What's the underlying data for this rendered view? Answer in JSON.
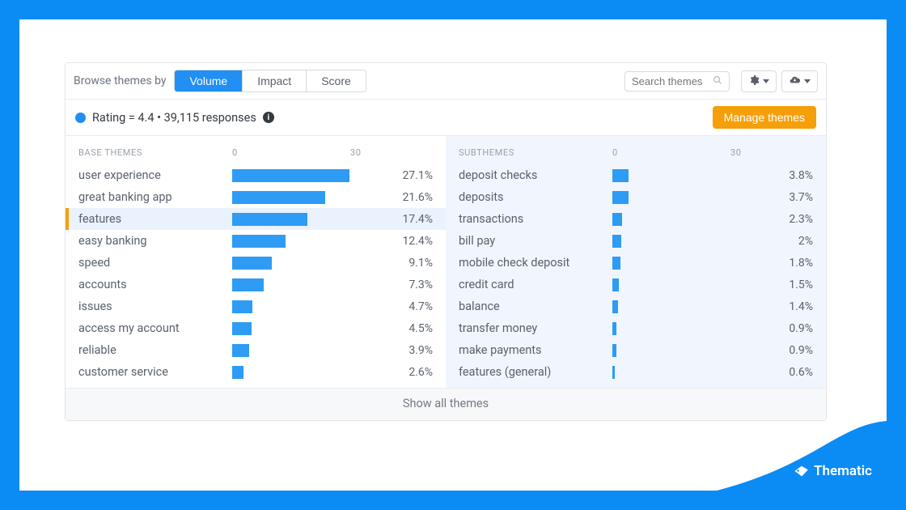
{
  "topbar": {
    "browse_label": "Browse themes by",
    "tabs": [
      "Volume",
      "Impact",
      "Score"
    ],
    "active_tab": 0,
    "search_placeholder": "Search themes"
  },
  "status": {
    "text": "Rating = 4.4 • 39,115 responses",
    "manage_label": "Manage themes"
  },
  "base": {
    "heading": "BASE THEMES",
    "axis_ticks": [
      "0",
      "30"
    ],
    "selected_index": 2,
    "rows": [
      {
        "label": "user experience",
        "pct": "27.1%",
        "value": 27.1
      },
      {
        "label": "great banking app",
        "pct": "21.6%",
        "value": 21.6
      },
      {
        "label": "features",
        "pct": "17.4%",
        "value": 17.4
      },
      {
        "label": "easy banking",
        "pct": "12.4%",
        "value": 12.4
      },
      {
        "label": "speed",
        "pct": "9.1%",
        "value": 9.1
      },
      {
        "label": "accounts",
        "pct": "7.3%",
        "value": 7.3
      },
      {
        "label": "issues",
        "pct": "4.7%",
        "value": 4.7
      },
      {
        "label": "access my account",
        "pct": "4.5%",
        "value": 4.5
      },
      {
        "label": "reliable",
        "pct": "3.9%",
        "value": 3.9
      },
      {
        "label": "customer service",
        "pct": "2.6%",
        "value": 2.6
      }
    ]
  },
  "sub": {
    "heading": "SUBTHEMES",
    "axis_ticks": [
      "0",
      "30"
    ],
    "rows": [
      {
        "label": "deposit checks",
        "pct": "3.8%",
        "value": 3.8
      },
      {
        "label": "deposits",
        "pct": "3.7%",
        "value": 3.7
      },
      {
        "label": "transactions",
        "pct": "2.3%",
        "value": 2.3
      },
      {
        "label": "bill pay",
        "pct": "2%",
        "value": 2.0
      },
      {
        "label": "mobile check deposit",
        "pct": "1.8%",
        "value": 1.8
      },
      {
        "label": "credit card",
        "pct": "1.5%",
        "value": 1.5
      },
      {
        "label": "balance",
        "pct": "1.4%",
        "value": 1.4
      },
      {
        "label": "transfer money",
        "pct": "0.9%",
        "value": 0.9
      },
      {
        "label": "make payments",
        "pct": "0.9%",
        "value": 0.9
      },
      {
        "label": "features (general)",
        "pct": "0.6%",
        "value": 0.6
      }
    ]
  },
  "show_all": "Show all themes",
  "brand": "Thematic",
  "chart_data": [
    {
      "type": "bar",
      "title": "BASE THEMES",
      "xlabel": "",
      "ylabel": "",
      "xlim": [
        0,
        30
      ],
      "categories": [
        "user experience",
        "great banking app",
        "features",
        "easy banking",
        "speed",
        "accounts",
        "issues",
        "access my account",
        "reliable",
        "customer service"
      ],
      "values": [
        27.1,
        21.6,
        17.4,
        12.4,
        9.1,
        7.3,
        4.7,
        4.5,
        3.9,
        2.6
      ],
      "unit": "%"
    },
    {
      "type": "bar",
      "title": "SUBTHEMES",
      "xlabel": "",
      "ylabel": "",
      "xlim": [
        0,
        30
      ],
      "categories": [
        "deposit checks",
        "deposits",
        "transactions",
        "bill pay",
        "mobile check deposit",
        "credit card",
        "balance",
        "transfer money",
        "make payments",
        "features (general)"
      ],
      "values": [
        3.8,
        3.7,
        2.3,
        2.0,
        1.8,
        1.5,
        1.4,
        0.9,
        0.9,
        0.6
      ],
      "unit": "%"
    }
  ]
}
